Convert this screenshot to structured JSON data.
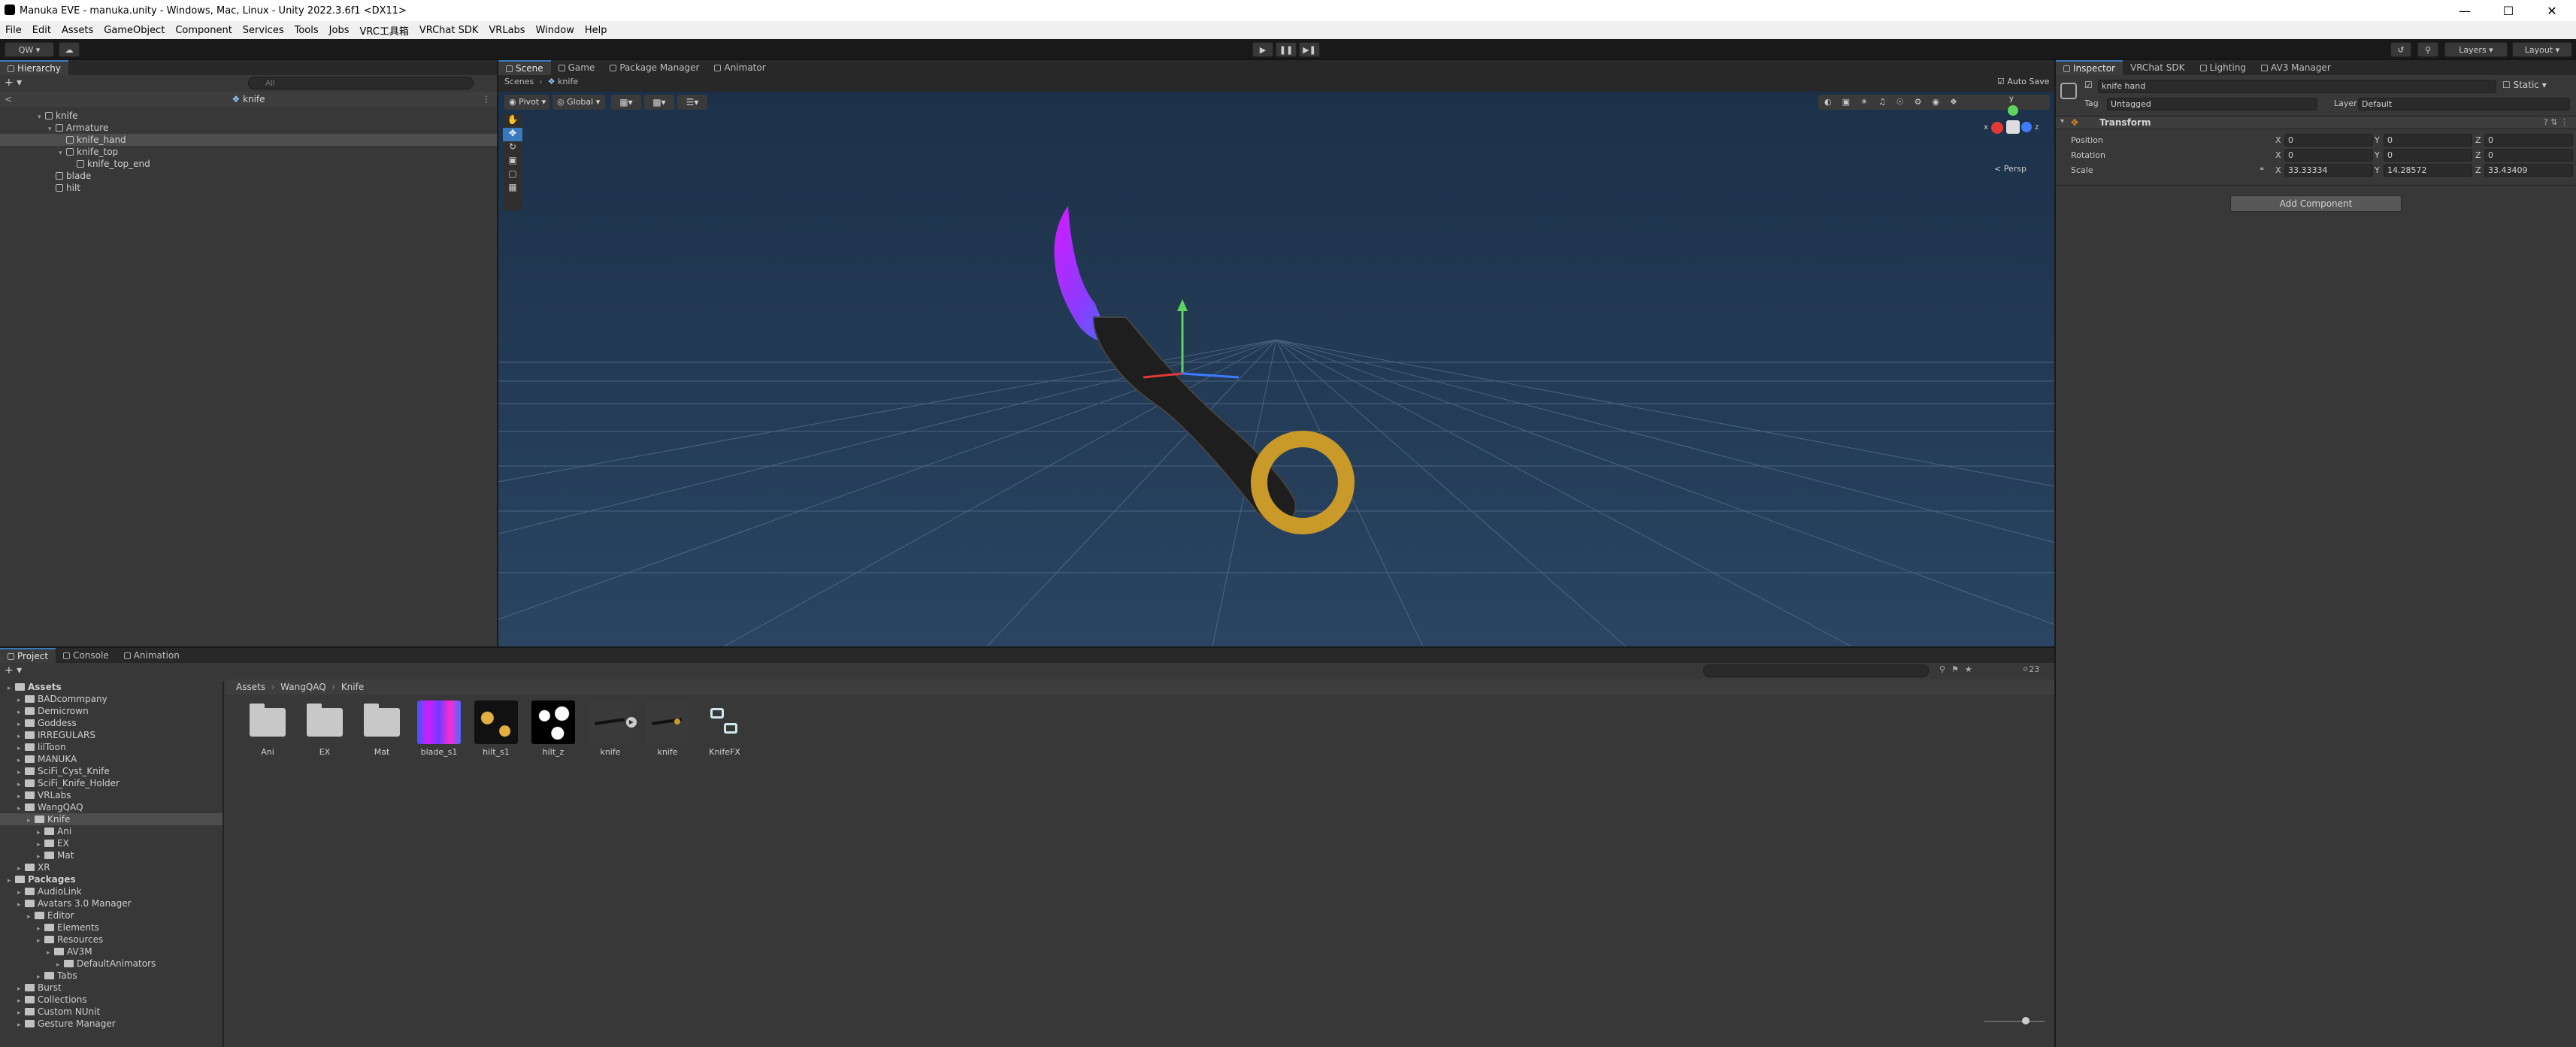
{
  "window": {
    "title": "Manuka EVE - manuka.unity - Windows, Mac, Linux - Unity 2022.3.6f1 <DX11>"
  },
  "menu": [
    "File",
    "Edit",
    "Assets",
    "GameObject",
    "Component",
    "Services",
    "Tools",
    "Jobs",
    "VRC工具箱",
    "VRChat SDK",
    "VRLabs",
    "Window",
    "Help"
  ],
  "toolbar": {
    "account": "QW",
    "layers": "Layers",
    "layout": "Layout"
  },
  "hierarchy": {
    "tab": "Hierarchy",
    "search_placeholder": "All",
    "scene_header": "knife",
    "rows": [
      "knife",
      "Armature",
      "knife_hand",
      "knife_top",
      "knife_top_end",
      "blade",
      "hilt"
    ]
  },
  "scene": {
    "tabs": [
      "Scene",
      "Game",
      "Package Manager",
      "Animator"
    ],
    "breadcrumb_root": "Scenes",
    "breadcrumb_item": "knife",
    "auto_save": "Auto Save",
    "pivot": "Pivot",
    "global": "Global",
    "persp": "< Persp",
    "gizmo_axes": [
      "y",
      "x",
      "z"
    ]
  },
  "inspector": {
    "tabs": [
      "Inspector",
      "VRChat SDK",
      "Lighting",
      "AV3 Manager"
    ],
    "object_name": "knife hand",
    "static": "Static",
    "tag_label": "Tag",
    "tag_value": "Untagged",
    "layer_label": "Layer",
    "layer_value": "Default",
    "component": "Transform",
    "position_label": "Position",
    "rotation_label": "Rotation",
    "scale_label": "Scale",
    "x_label": "X",
    "y_label": "Y",
    "z_label": "Z",
    "position": {
      "x": "0",
      "y": "0",
      "z": "0"
    },
    "rotation": {
      "x": "0",
      "y": "0",
      "z": "0"
    },
    "scale": {
      "x": "33.33334",
      "y": "14.28572",
      "z": "33.43409"
    },
    "add_component": "Add Component"
  },
  "bottom": {
    "tabs": [
      "Project",
      "Console",
      "Animation"
    ],
    "breadcrumb": [
      "Assets",
      "WangQAQ",
      "Knife"
    ],
    "count": "23",
    "tree": [
      {
        "label": "Assets",
        "indent": 0,
        "bold": true
      },
      {
        "label": "BADcommpany",
        "indent": 1
      },
      {
        "label": "Demicrown",
        "indent": 1
      },
      {
        "label": "Goddess",
        "indent": 1
      },
      {
        "label": "IRREGULARS",
        "indent": 1
      },
      {
        "label": "lilToon",
        "indent": 1
      },
      {
        "label": "MANUKA",
        "indent": 1
      },
      {
        "label": "SciFi_Cyst_Knife",
        "indent": 1
      },
      {
        "label": "SciFi_Knife_Holder",
        "indent": 1
      },
      {
        "label": "VRLabs",
        "indent": 1
      },
      {
        "label": "WangQAQ",
        "indent": 1
      },
      {
        "label": "Knife",
        "indent": 2,
        "sel": true
      },
      {
        "label": "Ani",
        "indent": 3
      },
      {
        "label": "EX",
        "indent": 3
      },
      {
        "label": "Mat",
        "indent": 3
      },
      {
        "label": "XR",
        "indent": 1
      },
      {
        "label": "Packages",
        "indent": 0,
        "bold": true
      },
      {
        "label": "AudioLink",
        "indent": 1
      },
      {
        "label": "Avatars 3.0 Manager",
        "indent": 1
      },
      {
        "label": "Editor",
        "indent": 2
      },
      {
        "label": "Elements",
        "indent": 3
      },
      {
        "label": "Resources",
        "indent": 3
      },
      {
        "label": "AV3M",
        "indent": 4
      },
      {
        "label": "DefaultAnimators",
        "indent": 5
      },
      {
        "label": "Tabs",
        "indent": 3
      },
      {
        "label": "Burst",
        "indent": 1
      },
      {
        "label": "Collections",
        "indent": 1
      },
      {
        "label": "Custom NUnit",
        "indent": 1
      },
      {
        "label": "Gesture Manager",
        "indent": 1
      }
    ],
    "assets": [
      "Ani",
      "EX",
      "Mat",
      "blade_s1",
      "hilt_s1",
      "hilt_z",
      "knife",
      "knife",
      "KnifeFX"
    ]
  },
  "colors": {
    "accent": "#3a79bb",
    "scene_bg": "#233b57",
    "panel": "#383838"
  }
}
